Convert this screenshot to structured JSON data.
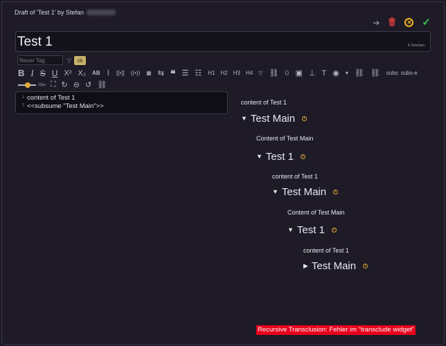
{
  "header": {
    "draft_label": "Draft of 'Test 1' by Stefan"
  },
  "actions": {
    "preview_arrow": "➔",
    "delete": "🗑",
    "cancel": "✕",
    "save": "✓"
  },
  "title_field": {
    "value": "Test 1",
    "char_count": "6 Zeichen"
  },
  "tags": {
    "placeholder": "Neuer Tag",
    "ok_label": "ok"
  },
  "toolbar": {
    "bold": "B",
    "italic": "I",
    "strike": "S",
    "underline": "U",
    "superscript": "X²",
    "subscript": "X₂",
    "smallcaps": "AB",
    "h1": "H1",
    "h2": "H2",
    "h3": "H3",
    "h4": "H4",
    "subs": "subs",
    "subs_e": "subs-e"
  },
  "toolbar2": {
    "zoom_label": "22px"
  },
  "editor": {
    "lines": [
      "content of Test 1",
      "<<subsume \"Test Main\">>"
    ],
    "line_numbers": [
      "1",
      "2"
    ]
  },
  "preview": {
    "level0_text": "content of Test 1",
    "level1_head": "Test Main",
    "level1_text": "Content of Test Main",
    "level2_head": "Test 1",
    "level2_text": "content of Test 1",
    "level3_head": "Test Main",
    "level3_text": "Content of Test Main",
    "level4_head": "Test 1",
    "level4_text": "content of Test 1",
    "level5_head": "Test Main"
  },
  "error": {
    "message": "Recursive Transclusion: Fehler im “transclude widget”"
  },
  "colors": {
    "background": "#1d1a26",
    "accent": "#e1a93a",
    "danger": "#e03c3c",
    "success": "#3fbf4a",
    "error_bg": "#e8001c"
  }
}
